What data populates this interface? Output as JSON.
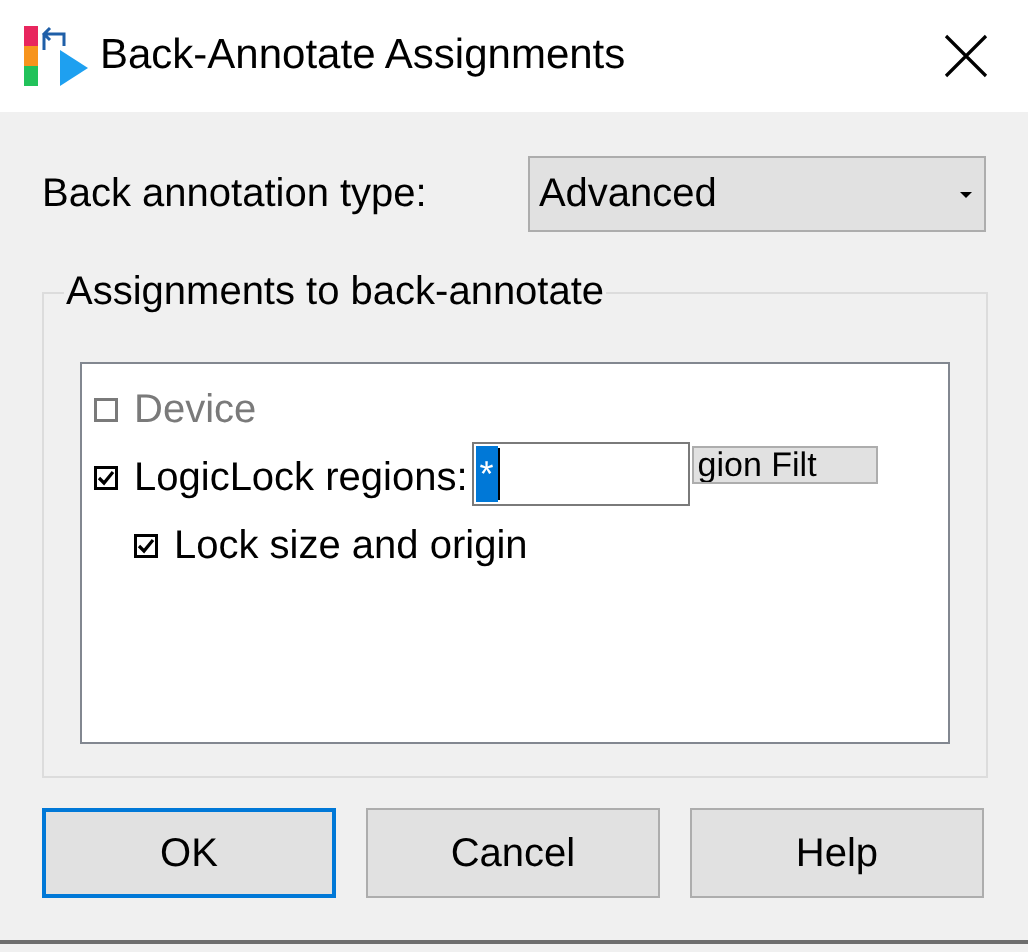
{
  "window": {
    "title": "Back-Annotate Assignments"
  },
  "annotation_type": {
    "label": "Back annotation type:",
    "value": "Advanced"
  },
  "group": {
    "title": "Assignments to back-annotate",
    "items": [
      {
        "label": "Device",
        "checked": false,
        "disabled": true
      },
      {
        "label": "LogicLock regions:",
        "checked": true,
        "disabled": false,
        "field": {
          "value": "*",
          "selected": true
        },
        "button": "gion Filt",
        "children": [
          {
            "label": "Lock size and origin",
            "checked": true,
            "disabled": false
          }
        ]
      }
    ]
  },
  "buttons": [
    {
      "label": "OK",
      "default": true
    },
    {
      "label": "Cancel",
      "default": false
    },
    {
      "label": "Help",
      "default": false
    }
  ]
}
